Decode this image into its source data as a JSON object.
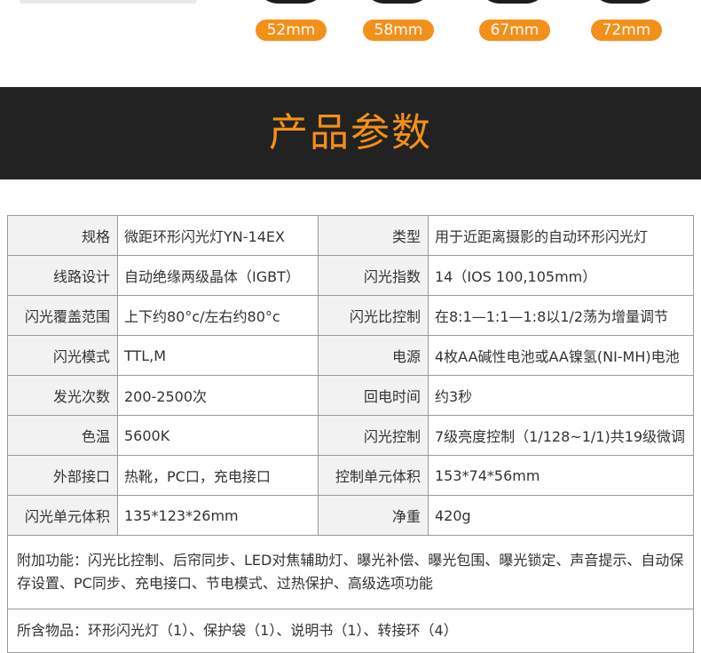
{
  "sizes": [
    "52mm",
    "58mm",
    "67mm",
    "72mm"
  ],
  "banner": {
    "title": "产品参数"
  },
  "specs": [
    [
      {
        "label": "规格",
        "value": "微距环形闪光灯YN-14EX"
      },
      {
        "label": "类型",
        "value": "用于近距离摄影的自动环形闪光灯"
      }
    ],
    [
      {
        "label": "线路设计",
        "value": "自动绝缘两级晶体（IGBT）"
      },
      {
        "label": "闪光指数",
        "value": "14（IOS 100,105mm）"
      }
    ],
    [
      {
        "label": "闪光覆盖范围",
        "value": "上下约80°c/左右约80°c"
      },
      {
        "label": "闪光比控制",
        "value": "在8:1—1:1—1:8以1/2荡为增量调节"
      }
    ],
    [
      {
        "label": "闪光模式",
        "value": "TTL,M"
      },
      {
        "label": "电源",
        "value": "4枚AA碱性电池或AA镍氢(NI-MH)电池"
      }
    ],
    [
      {
        "label": "发光次数",
        "value": "200-2500次"
      },
      {
        "label": "回电时间",
        "value": "约3秒"
      }
    ],
    [
      {
        "label": "色温",
        "value": "5600K"
      },
      {
        "label": "闪光控制",
        "value": "7级亮度控制（1/128~1/1)共19级微调"
      }
    ],
    [
      {
        "label": "外部接口",
        "value": "热靴，PC口，充电接口"
      },
      {
        "label": "控制单元体积",
        "value": "153*74*56mm"
      }
    ],
    [
      {
        "label": "闪光单元体积",
        "value": "135*123*26mm"
      },
      {
        "label": "净重",
        "value": "420g"
      }
    ]
  ],
  "notes": {
    "functions": "附加功能：闪光比控制、后帘同步、LED对焦辅助灯、曝光补偿、曝光包围、曝光锁定、声音提示、自动保存设置、PC同步、充电接口、节电模式、过热保护、高级选项功能",
    "contents": "所含物品：环形闪光灯（1）、保护袋（1）、说明书（1）、转接环（4）"
  }
}
